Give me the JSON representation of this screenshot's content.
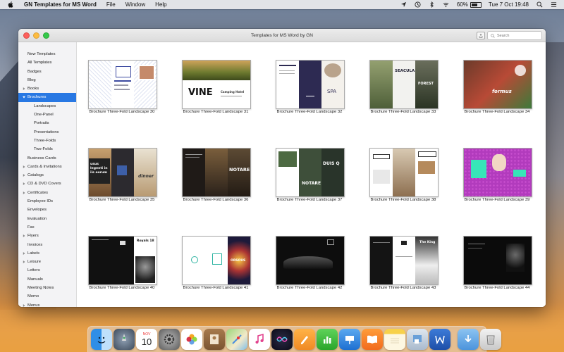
{
  "menubar": {
    "app_name": "GN Templates for MS Word",
    "menus": [
      "File",
      "Window",
      "Help"
    ],
    "battery": "60%",
    "clock": "Tue 7 Oct  19:48"
  },
  "window": {
    "title": "Templates for MS Word by GN",
    "search_placeholder": "Search"
  },
  "sidebar": {
    "items": [
      {
        "label": "New Templates",
        "level": 0,
        "expandable": false
      },
      {
        "label": "All Templates",
        "level": 0,
        "expandable": false
      },
      {
        "label": "Badges",
        "level": 0,
        "expandable": false
      },
      {
        "label": "Blog",
        "level": 0,
        "expandable": false
      },
      {
        "label": "Books",
        "level": 0,
        "expandable": true
      },
      {
        "label": "Brochures",
        "level": 0,
        "expandable": true,
        "expanded": true,
        "selected": true
      },
      {
        "label": "Landscapes",
        "level": 1,
        "expandable": false
      },
      {
        "label": "One-Panel",
        "level": 1,
        "expandable": false
      },
      {
        "label": "Portraits",
        "level": 1,
        "expandable": false
      },
      {
        "label": "Presentations",
        "level": 1,
        "expandable": false
      },
      {
        "label": "Three-Folds",
        "level": 1,
        "expandable": false
      },
      {
        "label": "Two-Folds",
        "level": 1,
        "expandable": false
      },
      {
        "label": "Business Cards",
        "level": 0,
        "expandable": false
      },
      {
        "label": "Cards & Invitations",
        "level": 0,
        "expandable": true
      },
      {
        "label": "Catalogs",
        "level": 0,
        "expandable": true
      },
      {
        "label": "CD & DVD Covers",
        "level": 0,
        "expandable": true
      },
      {
        "label": "Certificates",
        "level": 0,
        "expandable": true
      },
      {
        "label": "Employee IDs",
        "level": 0,
        "expandable": false
      },
      {
        "label": "Envelopes",
        "level": 0,
        "expandable": false
      },
      {
        "label": "Evaluation",
        "level": 0,
        "expandable": false
      },
      {
        "label": "Fax",
        "level": 0,
        "expandable": false
      },
      {
        "label": "Flyers",
        "level": 0,
        "expandable": true
      },
      {
        "label": "Invoices",
        "level": 0,
        "expandable": false
      },
      {
        "label": "Labels",
        "level": 0,
        "expandable": true
      },
      {
        "label": "Leisure",
        "level": 0,
        "expandable": true
      },
      {
        "label": "Letters",
        "level": 0,
        "expandable": false
      },
      {
        "label": "Manuals",
        "level": 0,
        "expandable": false
      },
      {
        "label": "Meeting Notes",
        "level": 0,
        "expandable": false
      },
      {
        "label": "Memo",
        "level": 0,
        "expandable": false
      },
      {
        "label": "Menus",
        "level": 0,
        "expandable": true
      }
    ]
  },
  "templates": [
    {
      "label": "Brochure Three-Fold Landscape 30",
      "thumb_texts": []
    },
    {
      "label": "Brochure Three-Fold Landscape 31",
      "thumb_texts": [
        "VINE",
        "Camping Hotel"
      ]
    },
    {
      "label": "Brochure Three-Fold Landscape 32",
      "thumb_texts": [
        "SPA"
      ]
    },
    {
      "label": "Brochure Three-Fold Landscape 33",
      "thumb_texts": [
        "SEACULA",
        "FOREST"
      ]
    },
    {
      "label": "Brochure Three-Fold Landscape 34",
      "thumb_texts": [
        "formus"
      ]
    },
    {
      "label": "Brochure Three-Fold Landscape 35",
      "thumb_texts": [
        "usus legenti in iis eorum",
        "dinner"
      ]
    },
    {
      "label": "Brochure Three-Fold Landscape 36",
      "thumb_texts": [
        "NOTARE"
      ]
    },
    {
      "label": "Brochure Three-Fold Landscape 37",
      "thumb_texts": [
        "NOTARE GOTHICA",
        "DUIS Q"
      ]
    },
    {
      "label": "Brochure Three-Fold Landscape 38",
      "thumb_texts": []
    },
    {
      "label": "Brochure Three-Fold Landscape 39",
      "thumb_texts": []
    },
    {
      "label": "Brochure Three-Fold Landscape 40",
      "thumb_texts": [
        "Royals 18"
      ]
    },
    {
      "label": "Brochure Three-Fold Landscape 41",
      "thumb_texts": [
        "ORSOUS"
      ]
    },
    {
      "label": "Brochure Three-Fold Landscape 42",
      "thumb_texts": []
    },
    {
      "label": "Brochure Three-Fold Landscape 43",
      "thumb_texts": [
        "The King"
      ]
    },
    {
      "label": "Brochure Three-Fold Landscape 44",
      "thumb_texts": []
    }
  ],
  "dock": {
    "apps": [
      "finder-icon",
      "launchpad-icon",
      "calendar-icon",
      "system-preferences-icon",
      "photos-icon",
      "contacts-icon",
      "maps-icon",
      "itunes-icon",
      "siri-icon",
      "pages-icon",
      "numbers-icon",
      "keynote-icon",
      "books-icon",
      "notes-icon",
      "preview-icon",
      "word-icon"
    ],
    "calendar_month": "NOV",
    "calendar_day": "10",
    "trailing": [
      "downloads-folder-icon",
      "trash-icon"
    ]
  },
  "colors": {
    "selection": "#2878e3",
    "sidebar_bg": "#f3f3f5"
  }
}
